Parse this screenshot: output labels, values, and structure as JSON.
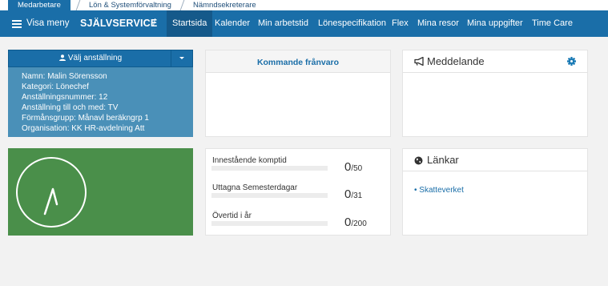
{
  "top_tabs": [
    "Medarbetare",
    "Lön & Systemförvaltning",
    "Nämndsekreterare"
  ],
  "nav": {
    "menu_label": "Visa meny",
    "brand": "SJÄLVSERVICE",
    "separator": "/",
    "items": [
      "Startsida",
      "Kalender",
      "Min arbetstid",
      "Lönespecifikation",
      "Flex",
      "Mina resor",
      "Mina uppgifter",
      "Time Care"
    ]
  },
  "employment": {
    "button_label": "Välj anställning",
    "lines": [
      "Namn: Malin Sörensson",
      "Kategori: Lönechef",
      "Anställningsnummer: 12",
      "Anställning till och med: TV",
      "Förmånsgrupp: Månavl beräkngrp 1",
      "Organisation: KK HR-avdelning Att"
    ]
  },
  "absence": {
    "title": "Kommande frånvaro"
  },
  "messages": {
    "title": "Meddelande"
  },
  "stats": [
    {
      "label": "Innestående komptid",
      "value": "0",
      "max": "/50",
      "fraction": 0
    },
    {
      "label": "Uttagna Semesterdagar",
      "value": "0",
      "max": "/31",
      "fraction": 0
    },
    {
      "label": "Övertid i år",
      "value": "0",
      "max": "/200",
      "fraction": 0
    }
  ],
  "links": {
    "title": "Länkar",
    "items": [
      "Skatteverket"
    ]
  },
  "colors": {
    "primary": "#1a6ea8",
    "employment_panel": "#4a90b8",
    "clock_panel": "#4a8f4a"
  }
}
